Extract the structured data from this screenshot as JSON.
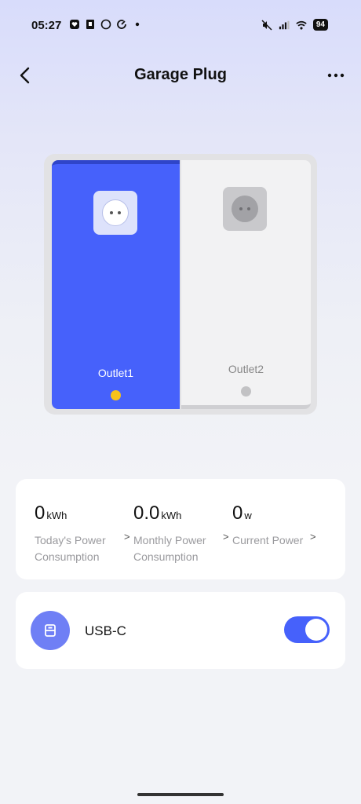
{
  "status_bar": {
    "time": "05:27",
    "battery": "94",
    "left_icons": [
      "heart-shield-icon",
      "sim-card-icon",
      "circle-icon",
      "refresh-icon",
      "dot-icon"
    ],
    "right_icons": [
      "mute-icon",
      "signal-icon",
      "wifi-icon"
    ]
  },
  "header": {
    "title": "Garage Plug",
    "back_icon": "chevron-left-icon",
    "more_icon": "more-horizontal-icon"
  },
  "plug": {
    "outlets": [
      {
        "label": "Outlet1",
        "state": "on",
        "accent": "#4661fb",
        "indicator_color": "#f6c21b"
      },
      {
        "label": "Outlet2",
        "state": "off",
        "accent": "#f2f2f3",
        "indicator_color": "#c2c2c4"
      }
    ]
  },
  "energy": {
    "today": {
      "value": "0",
      "unit": "kWh",
      "label": "Today's Power Consumption"
    },
    "monthly": {
      "value": "0.0",
      "unit": "kWh",
      "label": "Monthly Power Consumption"
    },
    "current": {
      "value": "0",
      "unit": "w",
      "label": "Current Power"
    }
  },
  "usb": {
    "label": "USB-C",
    "icon": "usb-port-icon",
    "toggle_on": true
  },
  "colors": {
    "brand": "#4661fb",
    "indicator_on": "#f6c21b"
  }
}
